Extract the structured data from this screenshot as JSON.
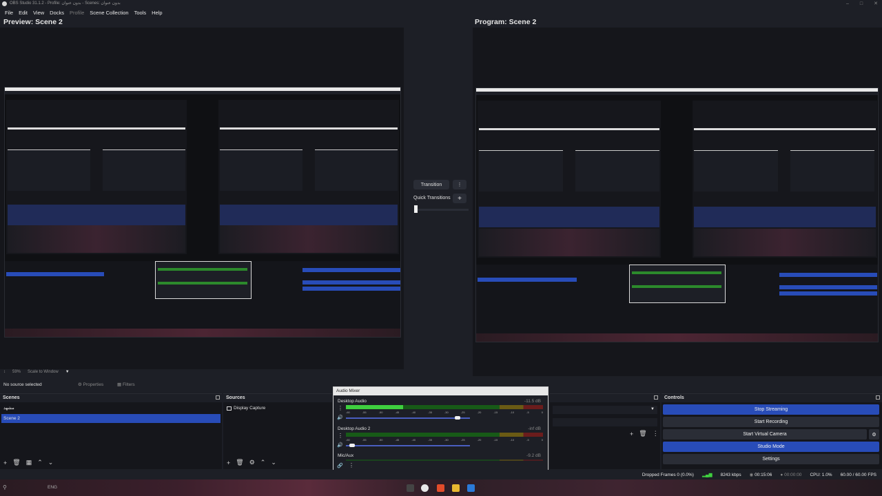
{
  "window": {
    "title": "OBS Studio 31.1.2 - Profile: بدون عنوان - Scenes: بدون عنوان"
  },
  "menu": [
    "File",
    "Edit",
    "View",
    "Docks",
    "Profile",
    "Scene Collection",
    "Tools",
    "Help"
  ],
  "preview": {
    "title": "Preview: Scene 2",
    "zoom": "59%",
    "scale_mode": "Scale to Window"
  },
  "program": {
    "title": "Program: Scene 2"
  },
  "transition": {
    "button_label": "Transition",
    "quick_label": "Quick Transitions"
  },
  "source_bar": {
    "no_source": "No source selected",
    "properties": "Properties",
    "filters": "Filters"
  },
  "scenes": {
    "title": "Scenes",
    "items": [
      "مشهد",
      "Scene 2"
    ],
    "selected_index": 1
  },
  "sources": {
    "title": "Sources",
    "items": [
      "Display Capture"
    ]
  },
  "audio_mixer": {
    "title": "Audio Mixer",
    "channels": [
      {
        "name": "Desktop Audio",
        "db": "-11.5 dB",
        "level": 0.29,
        "volume": 0.9
      },
      {
        "name": "Desktop Audio 2",
        "db": "-inf dB",
        "level": 0.0,
        "volume": 0.05
      },
      {
        "name": "Mic/Aux",
        "db": "-9.2 dB",
        "level": 0.0,
        "volume": 0.0
      }
    ],
    "scale": [
      "-60",
      "-55",
      "-50",
      "-45",
      "-40",
      "-35",
      "-30",
      "-25",
      "-20",
      "-15",
      "-10",
      "-5",
      "0"
    ]
  },
  "controls": {
    "title": "Controls",
    "buttons": [
      "Stop Streaming",
      "Start Recording",
      "Start Virtual Camera",
      "Studio Mode",
      "Settings"
    ]
  },
  "status": {
    "dropped": "Dropped Frames 0 (0.0%)",
    "bitrate": "8243 kbps",
    "stream_time": "00:15:06",
    "rec_time": "00:00:00",
    "cpu": "CPU: 1.0%",
    "fps": "60.00 / 60.00 FPS"
  },
  "taskbar": {
    "lang": "ENG"
  },
  "colors": {
    "accent": "#284cb8",
    "panel": "#15161b",
    "chrome": "#1d1f26"
  }
}
